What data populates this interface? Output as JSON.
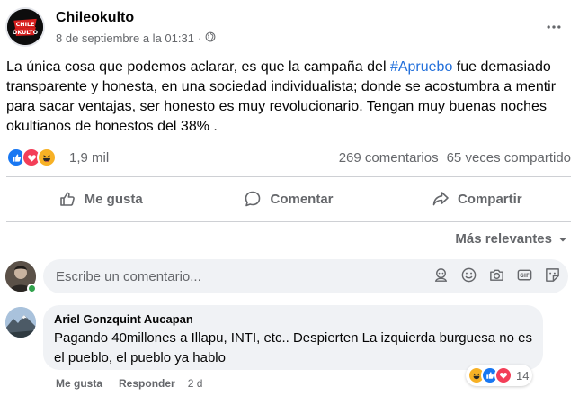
{
  "post": {
    "page_name": "Chileokulto",
    "avatar_text": "CHILE OKULTO",
    "timestamp": "8 de septiembre a la 01:31",
    "separator": "·",
    "text_before": "La única cosa que podemos aclarar, es que la campaña del ",
    "hashtag": "#Apruebo",
    "text_after": " fue demasiado transparente y honesta, en una sociedad individualista; donde se acostumbra a mentir para sacar ventajas, ser honesto es muy revolucionario. Tengan muy buenas noches okultianos de honestos del 38% ."
  },
  "stats": {
    "reactions": "1,9 mil",
    "comments": "269 comentarios",
    "shares": "65 veces compartido",
    "reaction_icons": [
      "like-icon",
      "love-icon",
      "haha-icon"
    ]
  },
  "actions": {
    "like": "Me gusta",
    "comment": "Comentar",
    "share": "Compartir"
  },
  "comments_section": {
    "sort_label": "Más relevantes",
    "input_placeholder": "Escribe un comentario...",
    "input_icons": [
      "avatar-sticker-icon",
      "emoji-icon",
      "camera-icon",
      "gif-icon",
      "sticker-icon"
    ]
  },
  "comment": {
    "author": "Ariel Gonzquint Aucapan",
    "text": "Pagando 40millones a Illapu, INTI, etc.. Despierten La izquierda burguesa no es el pueblo, el pueblo ya hablo",
    "reaction_count": "14",
    "reaction_icons": [
      "haha-icon",
      "like-icon",
      "love-icon"
    ],
    "like_label": "Me gusta",
    "reply_label": "Responder",
    "time": "2 d"
  },
  "colors": {
    "like_blue": "#1877f2",
    "love_red": "#f33e58",
    "haha_yellow": "#f7b125",
    "hashtag_blue": "#216fdb",
    "muted": "#65676b"
  }
}
